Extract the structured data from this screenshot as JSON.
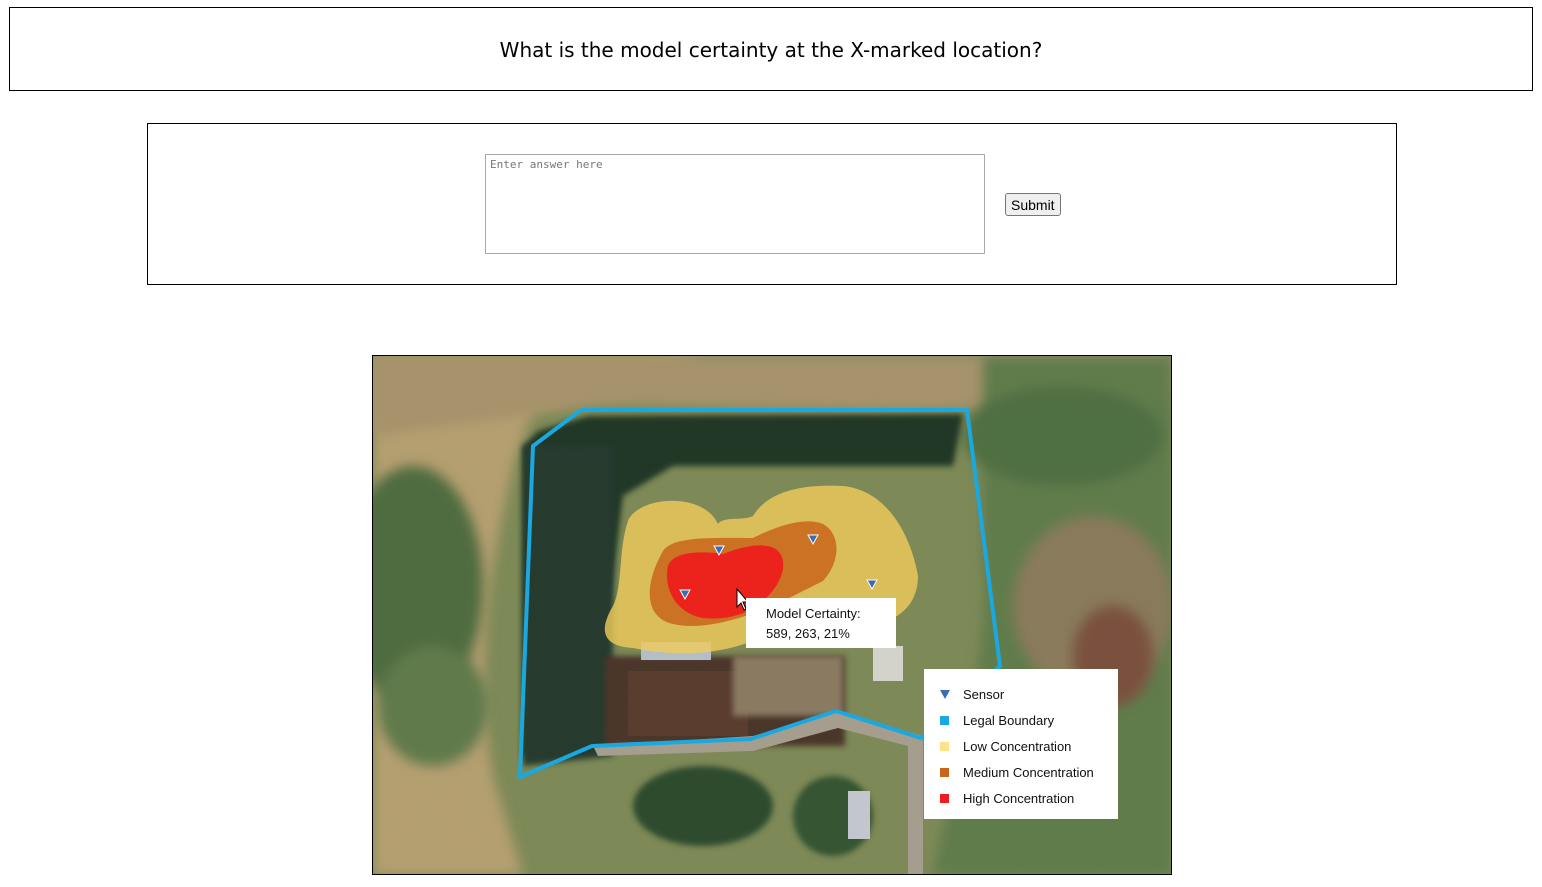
{
  "question": {
    "text": "What is the model certainty at the X-marked location?"
  },
  "answer": {
    "placeholder": "Enter answer here",
    "value": "",
    "submit_label": "Submit"
  },
  "map": {
    "tooltip": {
      "label": "Model Certainty:",
      "value": "589, 263, 21%"
    },
    "legend": {
      "items": [
        {
          "label": "Sensor",
          "symbol": "triangle-down",
          "color": "#3a6db3"
        },
        {
          "label": "Legal Boundary",
          "symbol": "square",
          "color": "#1aa8e0"
        },
        {
          "label": "Low Concentration",
          "symbol": "square",
          "color": "#fde28a"
        },
        {
          "label": "Medium Concentration",
          "symbol": "square",
          "color": "#c8651b"
        },
        {
          "label": "High Concentration",
          "symbol": "square",
          "color": "#ee1c1c"
        }
      ]
    },
    "colors": {
      "boundary": "#1aa8e0",
      "low": "#f0cc5a",
      "medium": "#c8651b",
      "high": "#ee1c1c",
      "sensor": "#3a6db3"
    },
    "sensor_count": 4
  }
}
